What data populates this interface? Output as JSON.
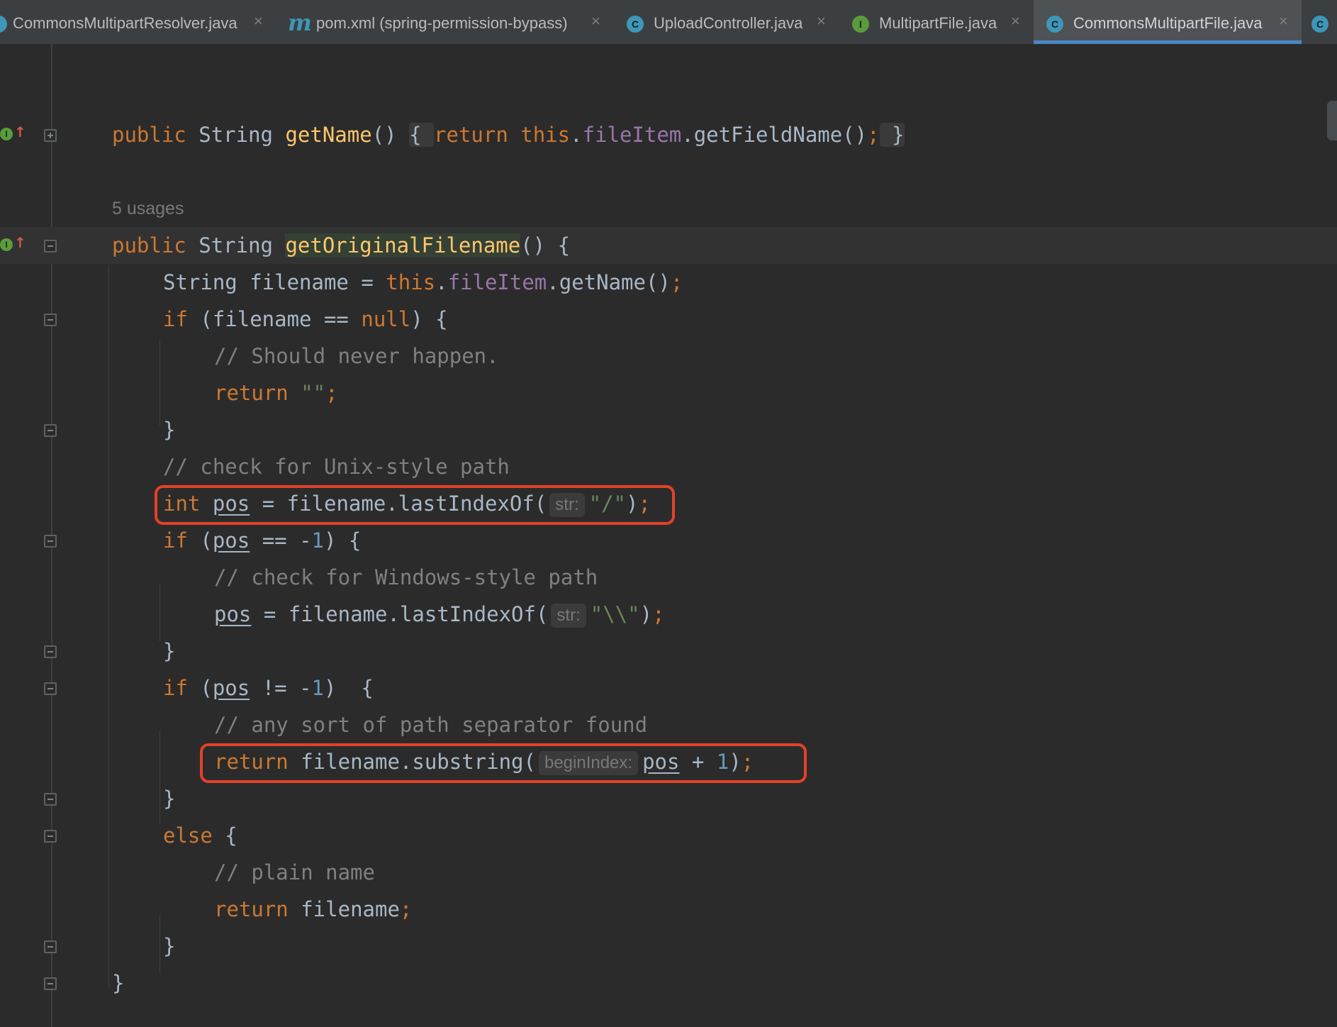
{
  "tabs": [
    {
      "icon": "class-icon",
      "label": "CommonsMultipartResolver.java",
      "close": "×",
      "active": false
    },
    {
      "icon": "maven-icon",
      "icon_glyph": "m",
      "label": "pom.xml (spring-permission-bypass)",
      "close": "×",
      "active": false
    },
    {
      "icon": "class-icon",
      "icon_glyph": "C",
      "label": "UploadController.java",
      "close": "×",
      "active": false
    },
    {
      "icon": "interface-icon",
      "icon_glyph": "I",
      "label": "MultipartFile.java",
      "close": "×",
      "active": false
    },
    {
      "icon": "class-icon",
      "icon_glyph": "C",
      "label": "CommonsMultipartFile.java",
      "close": "×",
      "active": true
    },
    {
      "icon": "class-icon",
      "icon_glyph": "C",
      "label": "",
      "close": "",
      "active": false
    }
  ],
  "gutter": {
    "implements_glyph": "I",
    "implements_arrow": "↑"
  },
  "code": {
    "line1": {
      "public": "public",
      "type": "String",
      "name": "getName",
      "paren": "()",
      "lbrace": "{",
      "ret": "return",
      "this": "this",
      "dot1": ".",
      "field": "fileItem",
      "call": ".getFieldName()",
      "semi": ";",
      "rbrace": "}"
    },
    "usages": "5 usages",
    "line2": {
      "public": "public",
      "type": "String",
      "name": "getOriginalFilename",
      "rest": "() {"
    },
    "line3": {
      "type": "String filename = ",
      "this": "this",
      "dot": ".",
      "field": "fileItem",
      "call": ".getName()",
      "semi": ";"
    },
    "line4": {
      "kw": "if",
      "a": " (filename == ",
      "null": "null",
      "b": ") {"
    },
    "line5": {
      "comment": "// Should never happen."
    },
    "line6": {
      "ret": "return",
      "str": " \"\"",
      "semi": ";"
    },
    "line7": {
      "brace": "}"
    },
    "line8": {
      "comment": "// check for Unix-style path"
    },
    "line9": {
      "int": "int",
      "var": "pos",
      "a": " = filename.lastIndexOf(",
      "hint": "str:",
      "str": "\"/\"",
      "b": ")",
      "semi": ";"
    },
    "line10": {
      "kw": "if",
      "a": " (",
      "var": "pos",
      "b": " == -",
      "num": "1",
      "c": ") {"
    },
    "line11": {
      "comment": "// check for Windows-style path"
    },
    "line12": {
      "var": "pos",
      "a": " = filename.lastIndexOf(",
      "hint": "str:",
      "str": "\"\\\\\"",
      "b": ")",
      "semi": ";"
    },
    "line13": {
      "brace": "}"
    },
    "line14": {
      "kw": "if",
      "a": " (",
      "var": "pos",
      "b": " != -",
      "num": "1",
      "c": ")  {"
    },
    "line15": {
      "comment": "// any sort of path separator found"
    },
    "line16": {
      "ret": "return",
      "a": " filename.substring(",
      "hint": "beginIndex:",
      "var": "pos",
      "b": " + ",
      "num": "1",
      "c": ")",
      "semi": ";"
    },
    "line17": {
      "brace": "}"
    },
    "line18": {
      "kw": "else",
      "a": " {"
    },
    "line19": {
      "comment": "// plain name"
    },
    "line20": {
      "ret": "return",
      "a": " filename",
      "semi": ";"
    },
    "line21": {
      "brace": "}"
    },
    "line22": {
      "brace": "}"
    }
  },
  "colors": {
    "keyword": "#cc7832",
    "field": "#9876aa",
    "method": "#ffc66d",
    "comment": "#808080",
    "string": "#6a8759",
    "number": "#6897bb",
    "annotation_box": "#e2412a",
    "active_tab_underline": "#4a88c7"
  }
}
